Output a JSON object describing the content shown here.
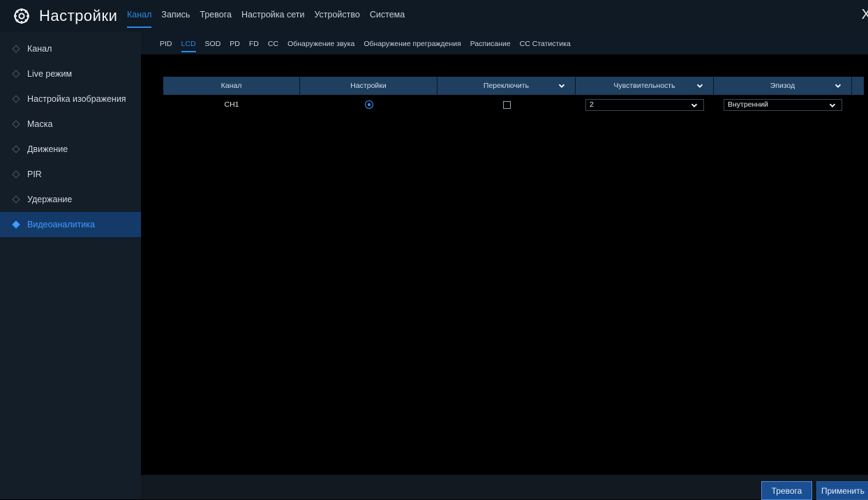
{
  "header": {
    "title": "Настройки",
    "gear_icon": "gear-icon",
    "tabs": [
      "Канал",
      "Запись",
      "Тревога",
      "Настройка сети",
      "Устройство",
      "Система"
    ],
    "active_tab": "Канал",
    "close_label": "X"
  },
  "sidebar": {
    "items": [
      {
        "label": "Канал"
      },
      {
        "label": "Live режим"
      },
      {
        "label": "Настройка изображения"
      },
      {
        "label": "Маска"
      },
      {
        "label": "Движение"
      },
      {
        "label": "PIR"
      },
      {
        "label": "Удержание"
      },
      {
        "label": "Видеоаналитика"
      }
    ],
    "active": "Видеоаналитика"
  },
  "subtabs": {
    "items": [
      "PID",
      "LCD",
      "SOD",
      "PD",
      "FD",
      "CC",
      "Обнаружение звука",
      "Обнаружение преграждения",
      "Расписание",
      "CC Статистика"
    ],
    "active": "LCD"
  },
  "table": {
    "headers": {
      "channel": "Канал",
      "settings": "Настройки",
      "switch": "Переключить",
      "sensitivity": "Чувствительность",
      "episode": "Эпизод"
    },
    "rows": [
      {
        "channel": "CH1",
        "settings_selected": true,
        "switch_checked": false,
        "sensitivity": "2",
        "episode": "Внутренний"
      }
    ]
  },
  "footer": {
    "alarm_button": "Тревога",
    "apply_button": "Применить"
  },
  "colors": {
    "accent": "#2f88e8",
    "header_bg": "#0f1a24",
    "sidebar_bg": "#141e29",
    "active_item_bg": "#143a6a",
    "table_header_bg": "#1e3f5f",
    "button_bg": "#1a4f93"
  }
}
